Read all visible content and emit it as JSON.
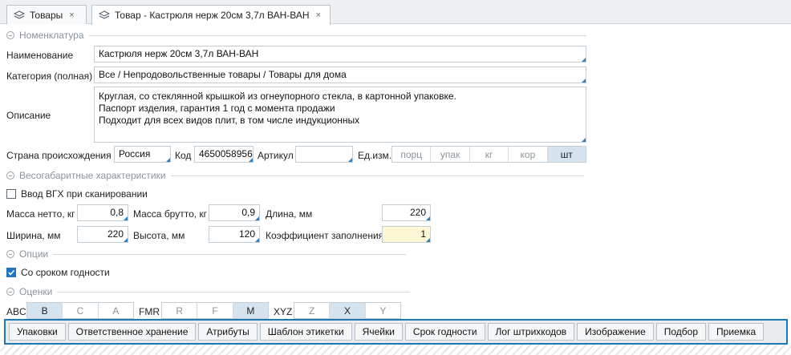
{
  "tabs": [
    {
      "label": "Товары",
      "close": "×"
    },
    {
      "label": "Товар - Кастрюля нерж 20см 3,7л ВАН-ВАН",
      "close": "×"
    }
  ],
  "sections": {
    "nomenclature": "Номенклатура",
    "dimensions": "Весогабаритные характеристики",
    "options": "Опции",
    "ratings": "Оценки"
  },
  "form": {
    "name_label": "Наименование",
    "name_value": "Кастрюля нерж 20см 3,7л ВАН-ВАН",
    "category_label": "Категория (полная)",
    "category_value": "Все / Непродовольственные товары / Товары для дома",
    "description_label": "Описание",
    "description_lines": [
      "Круглая, со стеклянной крышкой из огнеупорного стекла, в картонной упаковке.",
      "Паспорт изделия, гарантия 1 год с момента продажи",
      "Подходит для всех видов плит, в том числе индукционных"
    ],
    "country_label": "Страна происхождения",
    "country_value": "Россия",
    "code_label": "Код",
    "code_value": "4650058956",
    "article_label": "Артикул",
    "article_value": "",
    "unit_label": "Ед.изм.",
    "units": [
      "порц",
      "упак",
      "кг",
      "кор",
      "шт"
    ],
    "unit_selected": "шт"
  },
  "dims": {
    "vgh_scan_label": "Ввод ВГХ при сканировании",
    "vgh_scan_checked": false,
    "net_label": "Масса нетто, кг",
    "net_value": "0,8",
    "gross_label": "Масса брутто, кг",
    "gross_value": "0,9",
    "length_label": "Длина, мм",
    "length_value": "220",
    "width_label": "Ширина, мм",
    "width_value": "220",
    "height_label": "Высота, мм",
    "height_value": "120",
    "fill_label": "Коэффициент заполнения",
    "fill_value": "1"
  },
  "options": {
    "shelf_life_label": "Со сроком годности",
    "shelf_life_checked": true
  },
  "ratings": {
    "abc_label": "ABC",
    "abc": [
      "B",
      "C",
      "A"
    ],
    "abc_selected": "B",
    "fmr_label": "FMR",
    "fmr": [
      "R",
      "F",
      "M"
    ],
    "fmr_selected": "M",
    "xyz_label": "XYZ",
    "xyz": [
      "Z",
      "X",
      "Y"
    ],
    "xyz_selected": "X"
  },
  "bottom_tabs": [
    "Упаковки",
    "Ответственное хранение",
    "Атрибуты",
    "Шаблон этикетки",
    "Ячейки",
    "Срок годности",
    "Лог штрихкодов",
    "Изображение",
    "Подбор",
    "Приемка"
  ],
  "colors": {
    "accent": "#1f78b4",
    "selected_segment": "#d5e3ee",
    "fill_highlight": "#fdf7d6"
  }
}
